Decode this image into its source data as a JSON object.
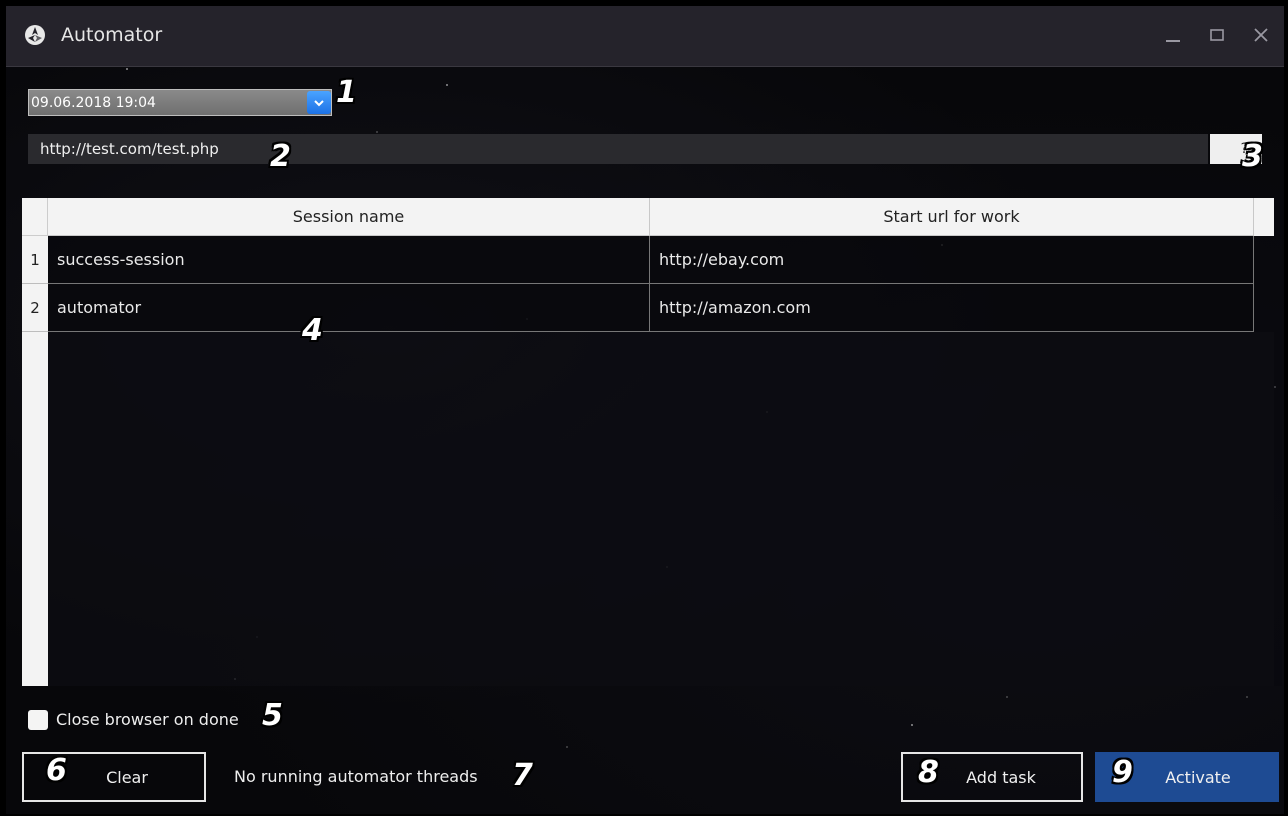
{
  "window": {
    "title": "Automator",
    "controls": [
      "minimize-icon",
      "maximize-icon",
      "close-icon"
    ]
  },
  "date_select": {
    "value": "09.06.2018 19:04",
    "accent": "#1d72e6"
  },
  "url_field": {
    "value": "http://test.com/test.php"
  },
  "help_button": {
    "label": "?"
  },
  "table": {
    "columns": [
      "Session name",
      "Start url for work"
    ],
    "rows": [
      {
        "num": "1",
        "session": "success-session",
        "url": "http://ebay.com"
      },
      {
        "num": "2",
        "session": "automator",
        "url": "http://amazon.com"
      }
    ]
  },
  "options": {
    "close_browser_label": "Close browser on done",
    "close_browser_checked": false
  },
  "footer": {
    "clear_label": "Clear",
    "status": "No running automator threads",
    "add_task_label": "Add task",
    "activate_label": "Activate",
    "activate_color": "#1e4b93"
  },
  "badges": [
    "1",
    "2",
    "3",
    "4",
    "5",
    "6",
    "7",
    "8",
    "9"
  ]
}
